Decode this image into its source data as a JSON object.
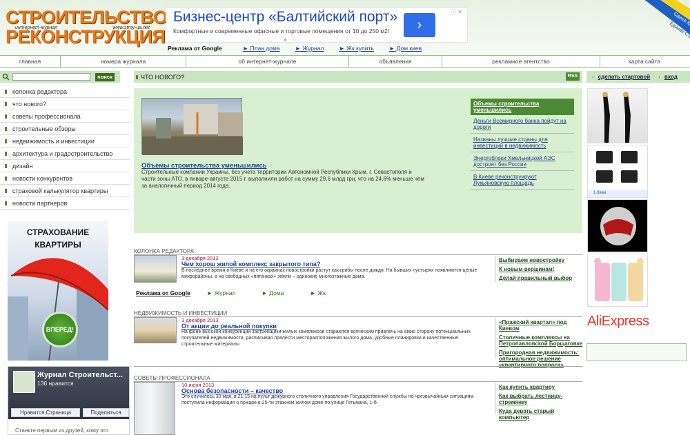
{
  "header": {
    "logo_line1": "СТРОИТЕЛЬСТВО",
    "logo_line2": "РЕКОНСТРУКЦИЯ",
    "logo_sub_left": "интернет-журнал",
    "logo_sub_right": "www.stroy-ua.net",
    "ribbon_line1": "Єдина Країна",
    "ribbon_line2": "Единая Страна"
  },
  "ad": {
    "title": "Бизнес-центр «Балтийский порт»",
    "description": "Комфортные и современные офисные и торговые помещения от 10 до 250 м2!",
    "arrow": "›",
    "dots": "● ○",
    "close_icons": "ⓘ ✕"
  },
  "ad_links": {
    "google": "Реклама от Google",
    "items": [
      "► План дома",
      "► Журнал",
      "► Жк купить",
      "► Дом киев"
    ]
  },
  "nav": [
    "главная",
    "номера журнала",
    "об интернет-журнале",
    "объявления",
    "рекламное агентство",
    "карта сайта"
  ],
  "search": {
    "placeholder": "",
    "button": "поиск"
  },
  "whats_new": {
    "title": "ЧТО НОВОГО?",
    "rss": "RSS"
  },
  "start_bar": {
    "make_start": "сделать стартовой",
    "login": "вход"
  },
  "sidebar": [
    "колонка редактора",
    "что нового?",
    "советы профессионала",
    "строительные обзоры",
    "недвижимость и инвестиции",
    "архитектура и градостроительство",
    "дизайн",
    "новости конкурентов",
    "страховой калькулятор квартиры",
    "новости партнеров"
  ],
  "insurance": {
    "line1": "СТРАХОВАНИЕ",
    "line2": "КВАРТИРЫ",
    "button": "ВПЕРЕД!"
  },
  "facebook": {
    "name": "Журнал Строительст...",
    "likes": "136 нравится",
    "like_btn": "Нравится Страница",
    "share_btn": "Поделиться",
    "footer": "Станьте первым из друзей, кому это"
  },
  "featured": {
    "title": "Объемы строительства уменьшились",
    "text": "Строительные компании Украины, без учета территории Автономной Республики Крым, г. Севастополя и части зоны АТО, в январе-августе 2015 г. выполнили работ на сумму 29,6 млрд грн, что на 24,6% меньше чем за аналогичный период 2014 года.",
    "list_head": "Объемы строительства уменьшились",
    "list": [
      "Деньги Всемирного банка пойдут на дороги",
      "Названы лучшие страны для инвестиций в недвижимость",
      "Энергоблоки Хмельницкой АЭС достроят без России",
      "В Киеве реконструируют Лукьяновскую площадь"
    ]
  },
  "sections": [
    {
      "title": "КОЛОНКА РЕДАКТОРА",
      "date": "3 декабря 2013",
      "headline": "Чем хорош жилой комплекс закрытого типа?",
      "text": "В последнее время в Киеве и на его окраинах новостройки растут как грибы после дождя. На бывших пустырях появляются целые микрорайоны, а на свободных «пятачках» земли – одинокие многоэтажные дома.",
      "links": [
        "Выбираем новостройку",
        "К новым вершинам!",
        "Делай правильный выбор"
      ]
    },
    {
      "title": "НЕДВИЖИМОСТЬ И ИНВЕСТИЦИИ",
      "date": "3 декабря 2013",
      "headline": "От акции до реальной покупки",
      "text": "На фоне высокой конкуренции застройщики жилых комплексов стараются всяческим привлечь на свою сторону потенциальных покупателей недвижимости, расписывая прелести месторасположения жилого дома, удобные планировки и качественные строительные материалы",
      "links": [
        "«Пражский квартал» под Киевом",
        "Столичные комплексы на Петропавловской Борщаговке",
        "Пригородная недвижимость: оптимальное решение «квартирного вопроса»"
      ]
    },
    {
      "title": "СОВЕТЫ ПРОФЕССИОНАЛА",
      "date": "10 июня 2013",
      "headline": "Основа безопасности – качество",
      "text": "Это случилось 30 мая, в 21:15 на пульт дежурного столичного управления Государственной службы по чрезвычайным ситуациям поступила информация о пожаре в 25-ти этажном жилом доме по улице Гетьмана, 1-б.",
      "links": [
        "Как купить квартиру",
        "Как выбрать лестницу-стремянку",
        "Куда девать старый компьютер"
      ]
    }
  ],
  "ad_links2": {
    "google": "Реклама от Google",
    "items": [
      "► Журнал",
      "► Дома",
      "► Жк"
    ]
  },
  "right_ads": {
    "aliexpress": "AliExpress",
    "badge": "1.0/мм"
  }
}
